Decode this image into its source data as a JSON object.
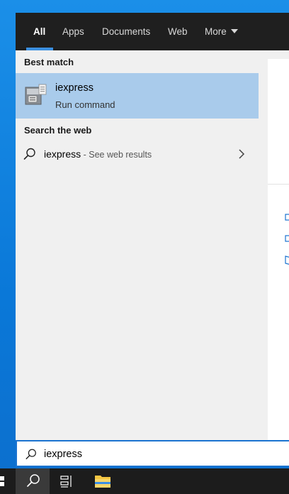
{
  "tabs": [
    {
      "label": "All",
      "active": true
    },
    {
      "label": "Apps"
    },
    {
      "label": "Documents"
    },
    {
      "label": "Web"
    },
    {
      "label": "More"
    }
  ],
  "best_match": {
    "section_label": "Best match",
    "title": "iexpress",
    "subtitle": "Run command",
    "icon": "iexpress-app-icon"
  },
  "web": {
    "section_label": "Search the web",
    "query": "iexpress",
    "suffix": " - See web results",
    "icon": "search-icon"
  },
  "search_box": {
    "value": "iexpress",
    "icon": "search-icon"
  },
  "taskbar": {
    "icons": [
      "start-icon",
      "search-icon",
      "task-view-icon",
      "file-explorer-icon"
    ]
  },
  "colors": {
    "accent": "#3b8fe0",
    "selected_row": "#a9cbeb",
    "tabbar_bg": "#1f1f1f",
    "taskbar_bg": "#1c1c1c",
    "desktop": "#0a78d8"
  }
}
